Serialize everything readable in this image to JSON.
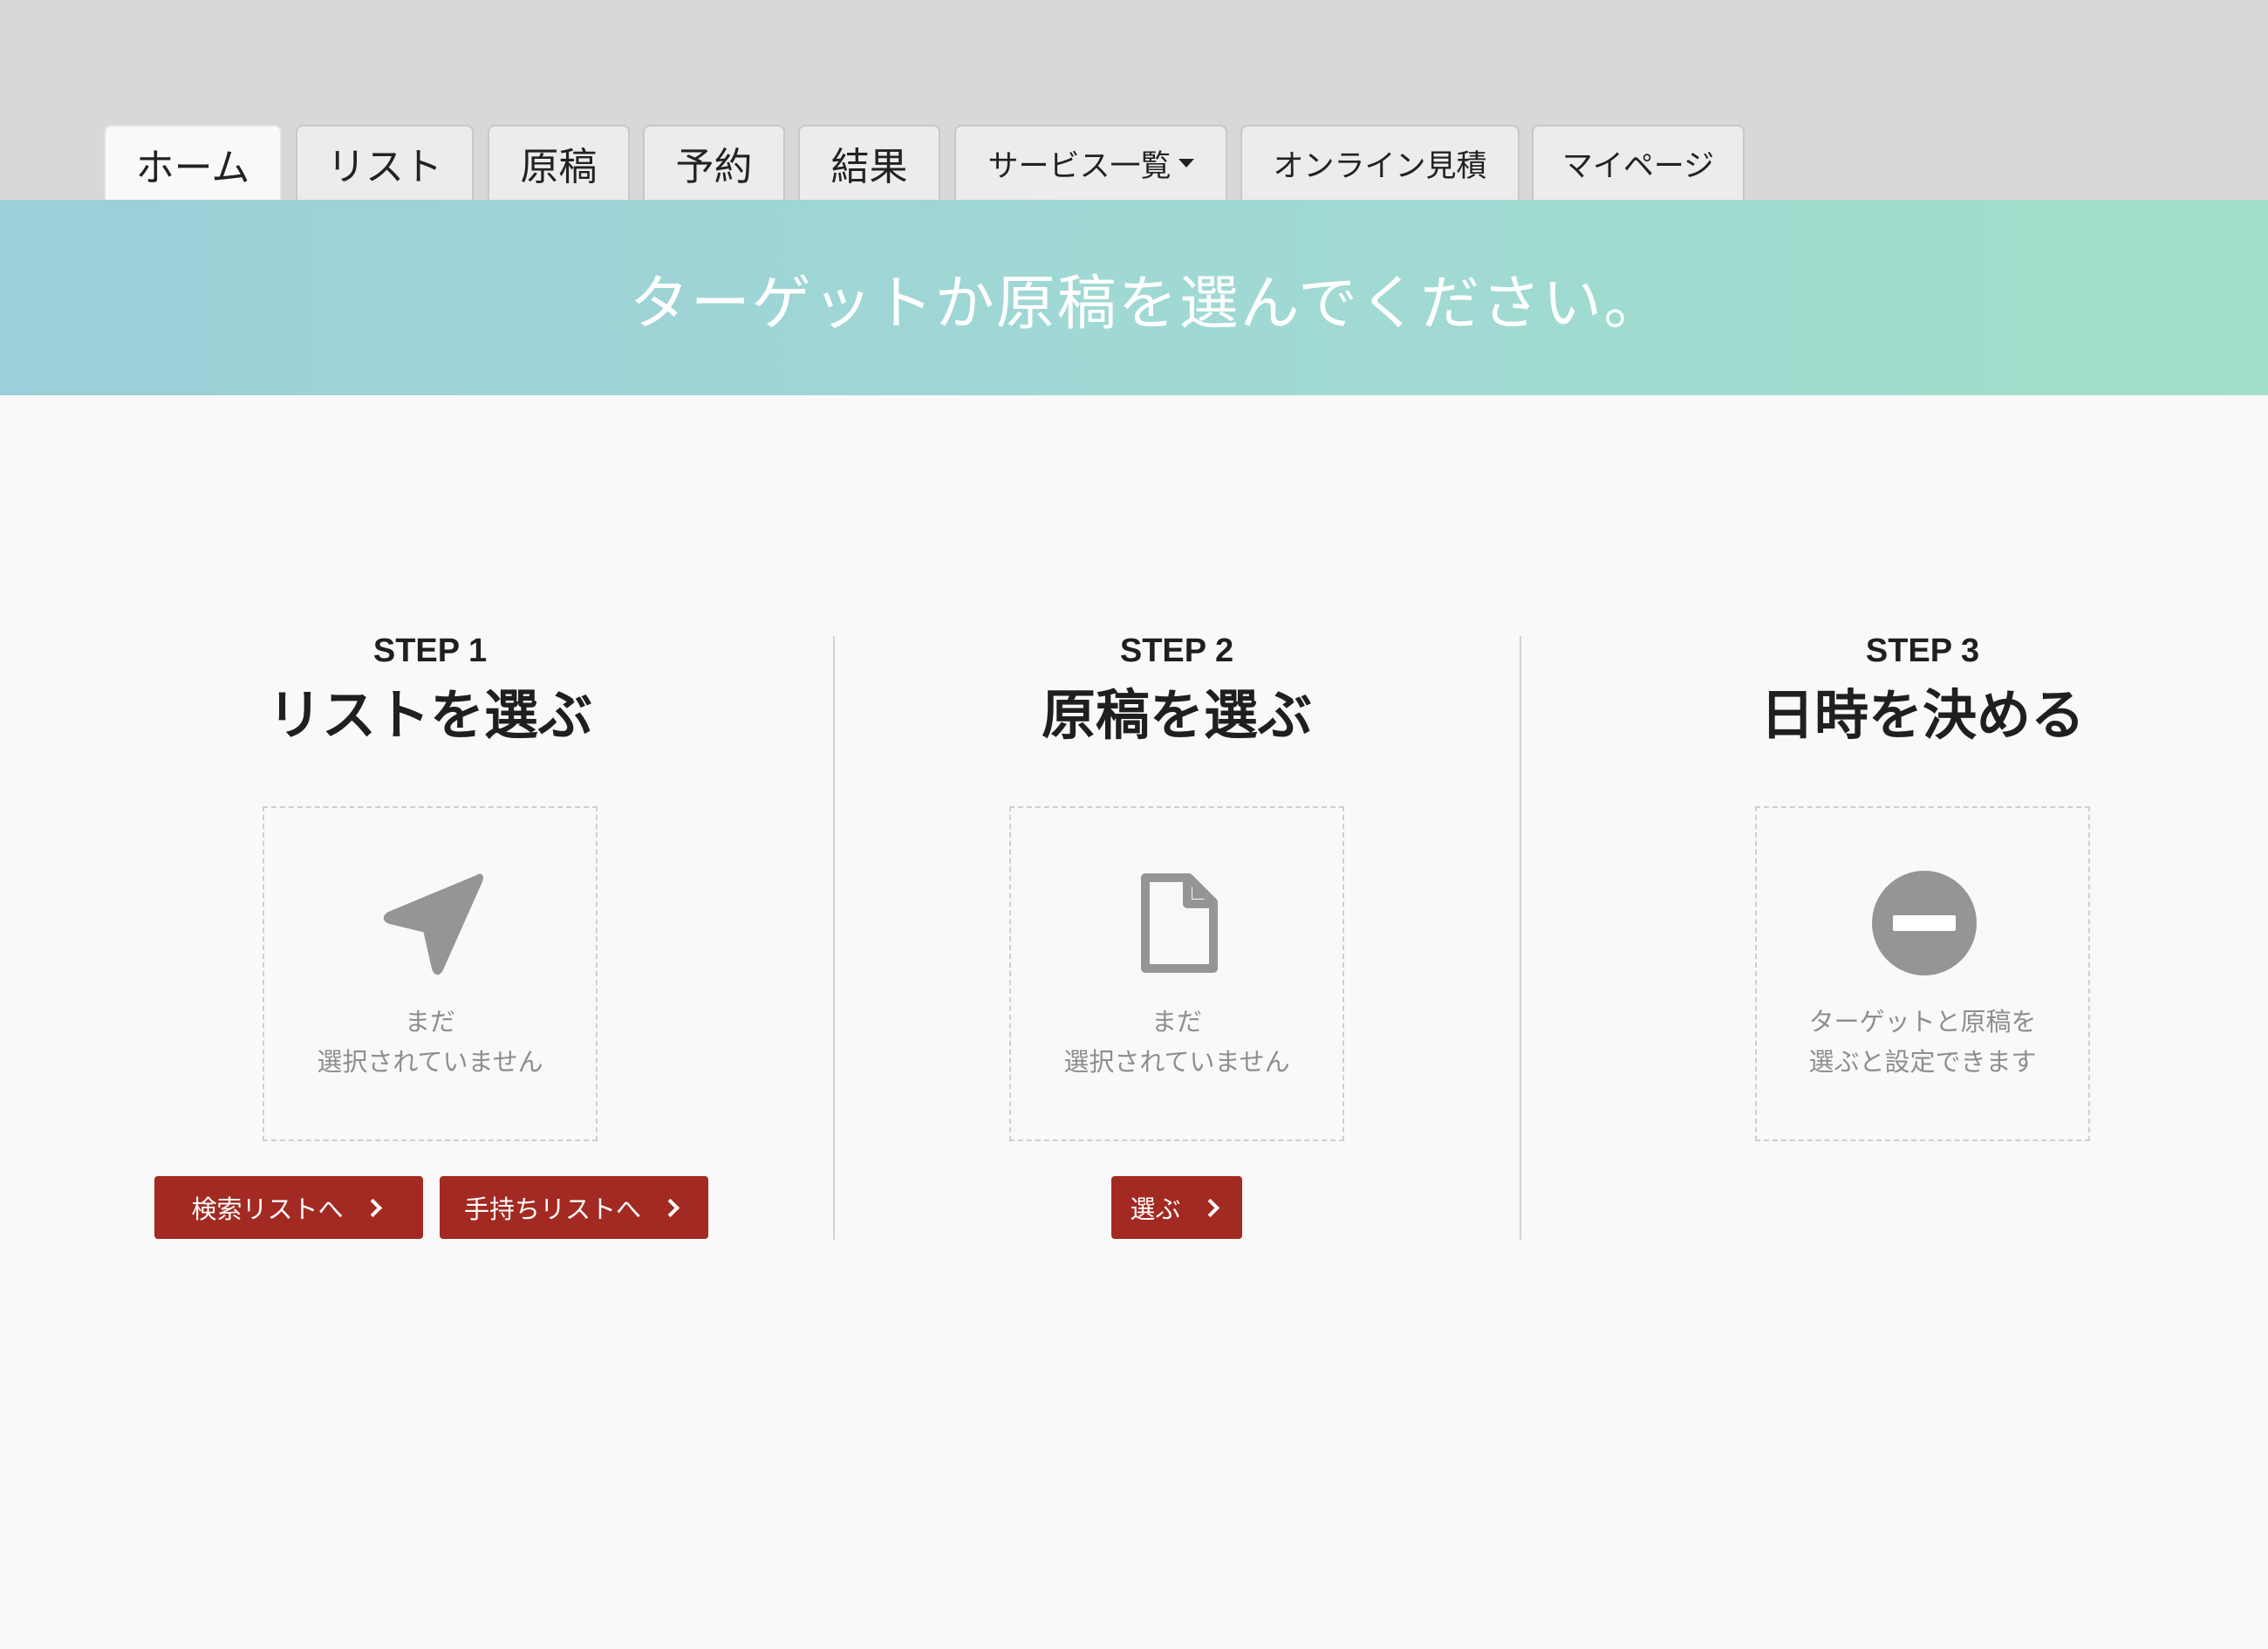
{
  "tabs": [
    {
      "label": "ホーム",
      "active": true
    },
    {
      "label": "リスト"
    },
    {
      "label": "原稿"
    },
    {
      "label": "予約"
    },
    {
      "label": "結果"
    },
    {
      "label": "サービス一覧",
      "dropdown": true
    },
    {
      "label": "オンライン見積"
    },
    {
      "label": "マイページ"
    }
  ],
  "banner": {
    "text": "ターゲットか原稿を選んでください。"
  },
  "steps": [
    {
      "step_label": "STEP 1",
      "title": "リストを選ぶ",
      "icon": "location-arrow-icon",
      "box_text": [
        "まだ",
        "選択されていません"
      ],
      "buttons": [
        "検索リストへ",
        "手持ちリストへ"
      ]
    },
    {
      "step_label": "STEP 2",
      "title": "原稿を選ぶ",
      "icon": "document-icon",
      "box_text": [
        "まだ",
        "選択されていません"
      ],
      "buttons": [
        "選ぶ"
      ]
    },
    {
      "step_label": "STEP 3",
      "title": "日時を決める",
      "icon": "minus-circle-icon",
      "box_text": [
        "ターゲットと原稿を",
        "選ぶと設定できます"
      ],
      "buttons": []
    }
  ],
  "colors": {
    "accent_button": "#a32a22",
    "icon_gray": "#959595",
    "banner_left": "#9ccfd9",
    "banner_right": "#a1dfca"
  }
}
